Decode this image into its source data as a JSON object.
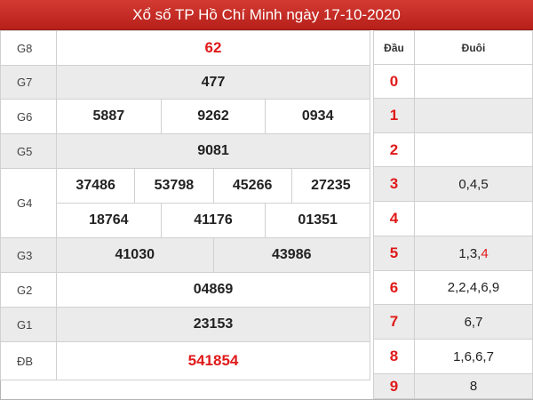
{
  "title": "Xổ số TP Hồ Chí Minh ngày 17-10-2020",
  "prizes": [
    {
      "label": "G8",
      "numbers": [
        "62"
      ],
      "red": true
    },
    {
      "label": "G7",
      "numbers": [
        "477"
      ]
    },
    {
      "label": "G6",
      "numbers": [
        "5887",
        "9262",
        "0934"
      ]
    },
    {
      "label": "G5",
      "numbers": [
        "9081"
      ]
    },
    {
      "label": "G4",
      "numbers_row1": [
        "37486",
        "53798",
        "45266",
        "27235"
      ],
      "numbers_row2": [
        "18764",
        "41176",
        "01351"
      ]
    },
    {
      "label": "G3",
      "numbers": [
        "41030",
        "43986"
      ]
    },
    {
      "label": "G2",
      "numbers": [
        "04869"
      ]
    },
    {
      "label": "G1",
      "numbers": [
        "23153"
      ]
    },
    {
      "label": "ĐB",
      "numbers": [
        "541854"
      ],
      "red": true
    }
  ],
  "dau_duoi": {
    "header_dau": "Đầu",
    "header_duoi": "Đuôi",
    "rows": [
      {
        "dau": "0",
        "duoi": ""
      },
      {
        "dau": "1",
        "duoi": ""
      },
      {
        "dau": "2",
        "duoi": ""
      },
      {
        "dau": "3",
        "duoi": "0,4,5"
      },
      {
        "dau": "4",
        "duoi": ""
      },
      {
        "dau": "5",
        "duoi": "1,3,",
        "duoi_red": "4"
      },
      {
        "dau": "6",
        "duoi": "2,2,4,6,9"
      },
      {
        "dau": "7",
        "duoi": "6,7"
      },
      {
        "dau": "8",
        "duoi": "1,6,6,7"
      },
      {
        "dau": "9",
        "duoi": "8"
      }
    ]
  },
  "colors": {
    "accent": "#c62a24",
    "highlight_red": "#e01a1a",
    "row_shade": "#ebebeb"
  }
}
